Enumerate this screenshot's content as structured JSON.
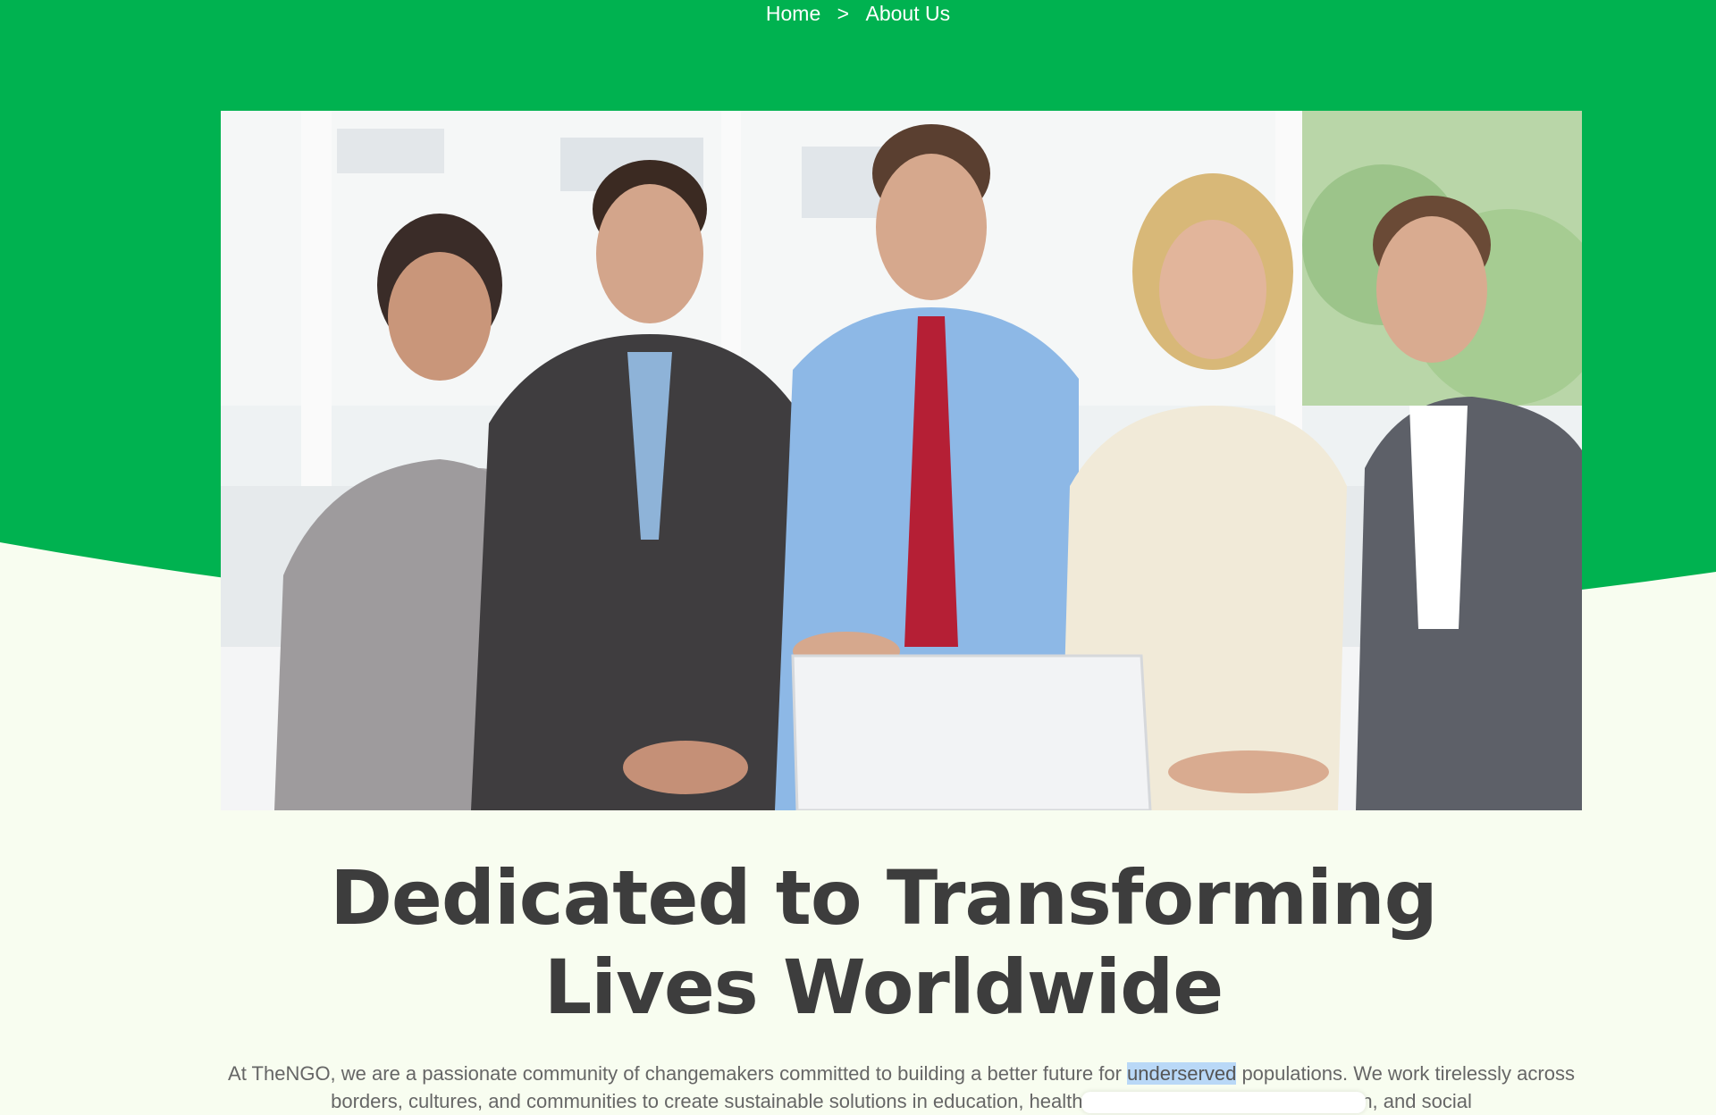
{
  "breadcrumb": {
    "home": "Home",
    "separator": ">",
    "current": "About Us"
  },
  "hero": {
    "image_alt": "Team of five smiling professionals seated at a table with a laptop",
    "headline": "Dedicated to Transforming Lives Worldwide"
  },
  "intro": {
    "text_before": "At TheNGO, we are a passionate community of changemakers committed to building a better future for ",
    "highlighted": "underserved",
    "text_after": " populations. We work tirelessly across borders, cultures, and communities to create sustainable solutions in education, healthcare, environmental conservation, and social"
  },
  "colors": {
    "brand_green": "#00b250",
    "page_bg": "#f8fdf0",
    "heading": "#3d3d3d",
    "body": "#666666",
    "selection": "#b9d8f7"
  }
}
